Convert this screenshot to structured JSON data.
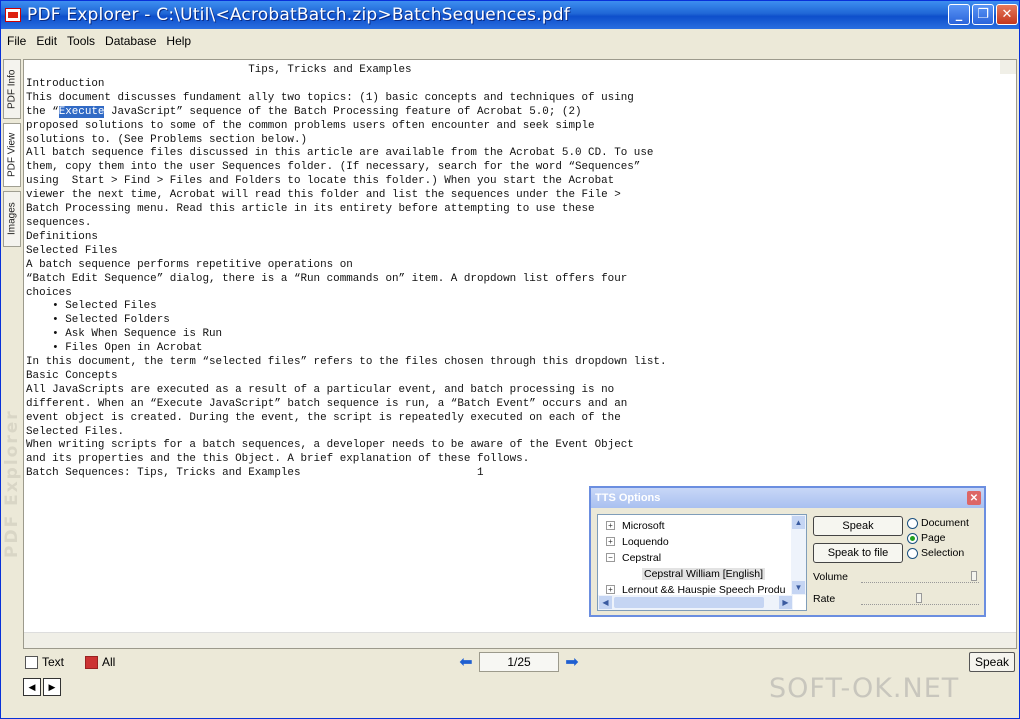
{
  "window": {
    "title": "PDF Explorer - C:\\Util\\<AcrobatBatch.zip>BatchSequences.pdf"
  },
  "menu": [
    "File",
    "Edit",
    "Tools",
    "Database",
    "Help"
  ],
  "left_tabs": {
    "pdf_info": "PDF Info",
    "pdf_view": "PDF View",
    "images": "Images",
    "logo": "PDF Explorer"
  },
  "document": {
    "lines": [
      "                                  Tips, Tricks and Examples",
      "Introduction",
      "This document discusses fundament ally two topics: (1) basic concepts and techniques of using",
      "the “Execute JavaScript” sequence of the Batch Processing feature of Acrobat 5.0; (2)",
      "proposed solutions to some of the common problems users often encounter and seek simple",
      "solutions to. (See Problems section below.)",
      "All batch sequence files discussed in this article are available from the Acrobat 5.0 CD. To use",
      "them, copy them into the user Sequences folder. (If necessary, search for the word “Sequences”",
      "using  Start > Find > Files and Folders to locate this folder.) When you start the Acrobat",
      "viewer the next time, Acrobat will read this folder and list the sequences under the File >",
      "Batch Processing menu. Read this article in its entirety before attempting to use these",
      "sequences.",
      "Definitions",
      "Selected Files",
      "A batch sequence performs repetitive operations on",
      "“Batch Edit Sequence” dialog, there is a “Run commands on” item. A dropdown list offers four",
      "choices",
      "    • Selected Files",
      "    • Selected Folders",
      "    • Ask When Sequence is Run",
      "    • Files Open in Acrobat",
      "In this document, the term “selected files” refers to the files chosen through this dropdown list.",
      "Basic Concepts",
      "All JavaScripts are executed as a result of a particular event, and batch processing is no",
      "different. When an “Execute JavaScript” batch sequence is run, a “Batch Event” occurs and an",
      "event object is created. During the event, the script is repeatedly executed on each of the",
      "Selected Files.",
      "When writing scripts for a batch sequences, a developer needs to be aware of the Event Object",
      "and its properties and the this Object. A brief explanation of these follows.",
      "Batch Sequences: Tips, Tricks and Examples                           1"
    ],
    "selected_word": "Execute"
  },
  "bottom_bar": {
    "tab_text": "Text",
    "tab_all": "All",
    "page_indicator": "1/25",
    "speak_button": "Speak"
  },
  "tts_options": {
    "title": "TTS Options",
    "voices": [
      {
        "label": "Microsoft",
        "toggle": "+"
      },
      {
        "label": "Loquendo",
        "toggle": "+"
      },
      {
        "label": "Cepstral",
        "toggle": "−"
      },
      {
        "label": "Cepstral William [English]",
        "child": true
      },
      {
        "label": "Lernout && Hauspie Speech Produ",
        "toggle": "+"
      }
    ],
    "speak_button": "Speak",
    "speak_to_file_button": "Speak to file",
    "scope_options": [
      "Document",
      "Page",
      "Selection"
    ],
    "scope_selected": "Page",
    "volume_label": "Volume",
    "rate_label": "Rate",
    "volume_level": 1.0,
    "rate_level": 0.5
  },
  "watermark": "SOFT-OK.NET",
  "colors": {
    "titlebar": "#1f66d6",
    "selection": "#316ac5",
    "window_bg": "#ece9d8"
  }
}
